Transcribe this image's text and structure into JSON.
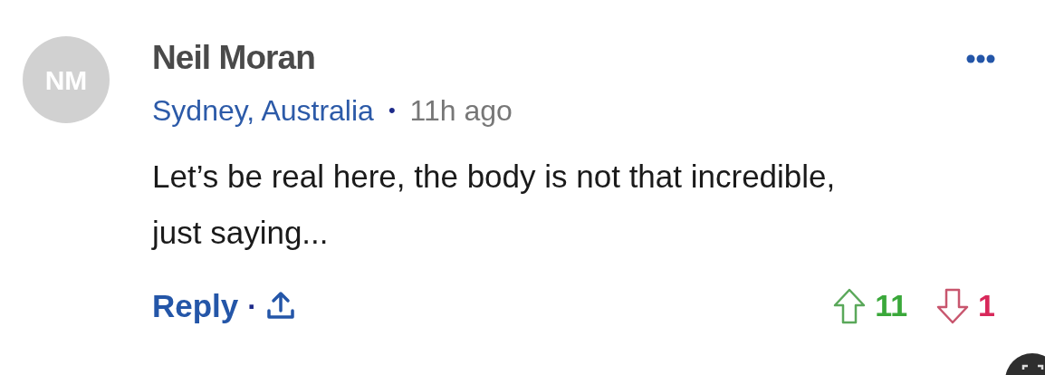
{
  "comment": {
    "avatar_initials": "NM",
    "author": "Neil Moran",
    "location": "Sydney, Australia",
    "separator": "•",
    "time": "11h ago",
    "text": "Let’s be real here, the body is not that incredible, just saying...",
    "reply_label": "Reply",
    "reply_separator": "·",
    "upvotes": "11",
    "downvotes": "1"
  }
}
